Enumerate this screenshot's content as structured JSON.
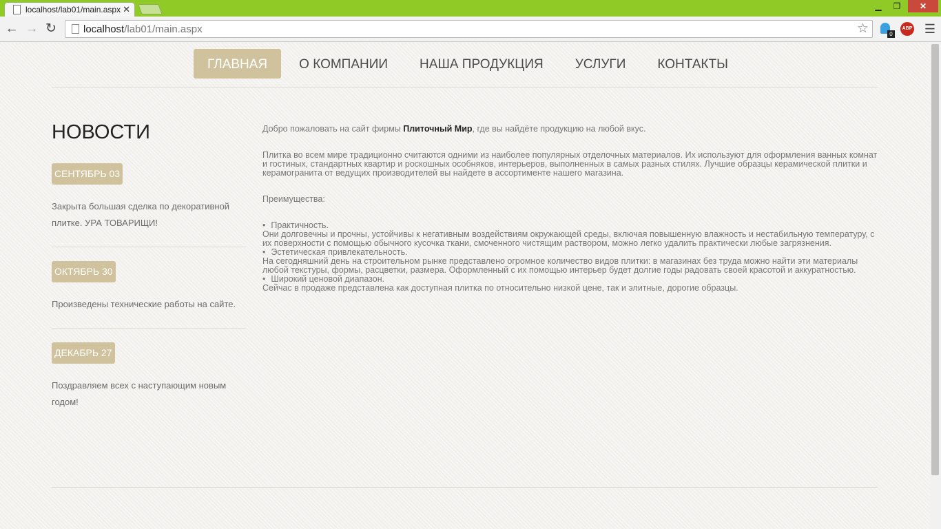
{
  "browser": {
    "tab_title": "localhost/lab01/main.aspx",
    "url_host": "localhost",
    "url_path": "/lab01/main.aspx",
    "extension_badge": "0",
    "abp_label": "ABP",
    "accent_color": "#8fca26"
  },
  "nav": {
    "items": [
      {
        "label": "ГЛАВНАЯ",
        "active": true
      },
      {
        "label": "О КОМПАНИИ",
        "active": false
      },
      {
        "label": "НАША ПРОДУКЦИЯ",
        "active": false
      },
      {
        "label": "УСЛУГИ",
        "active": false
      },
      {
        "label": "КОНТАКТЫ",
        "active": false
      }
    ]
  },
  "news": {
    "title": "НОВОСТИ",
    "items": [
      {
        "date": "СЕНТЯБРЬ 03",
        "text": "Закрыта большая сделка по декоративной плитке. УРА ТОВАРИЩИ!"
      },
      {
        "date": "ОКТЯБРЬ 30",
        "text": "Произведены технические работы на сайте."
      },
      {
        "date": "ДЕКАБРЬ 27",
        "text": "Поздравляем всех с наступающим новым годом!"
      }
    ]
  },
  "content": {
    "welcome_before": "Добро пожаловать на сайт фирмы ",
    "company": "Плиточный Мир",
    "welcome_after": ", где вы найдёте продукцию на любой вкус.",
    "intro": "Плитка во всем мире традиционно считаются одними из наиболее популярных отделочных материалов. Их используют для оформления ванных комнат и гостиных, стандартных квартир и роскошных особняков, интерьеров, выполненных в самых разных стилях. Лучшие образцы керамической плитки и керамогранита от ведущих производителей вы найдете в ассортименте нашего магазина.",
    "advantages_title": "Преимущества:",
    "advantages": [
      {
        "name": "Практичность.",
        "text": "Они долговечны и прочны, устойчивы к негативным воздействиям окружающей среды, включая повышенную влажность и нестабильную температуру, с их поверхности с помощью обычного кусочка ткани, смоченного чистящим раствором, можно легко удалить практически любые загрязнения."
      },
      {
        "name": "Эстетическая привлекательность.",
        "text": "На сегодняшний день на строительном рынке представлено огромное количество видов плитки: в магазинах без труда можно найти эти материалы любой текстуры, формы, расцветки, размера. Оформленный с их помощью интерьер будет долгие годы радовать своей красотой и аккуратностью."
      },
      {
        "name": "Широкий ценовой диапазон.",
        "text": "Сейчас в продаже представлена как доступная плитка по относительно низкой цене, так и элитные, дорогие образцы."
      }
    ]
  },
  "theme": {
    "badge_color": "#cfc29d"
  }
}
